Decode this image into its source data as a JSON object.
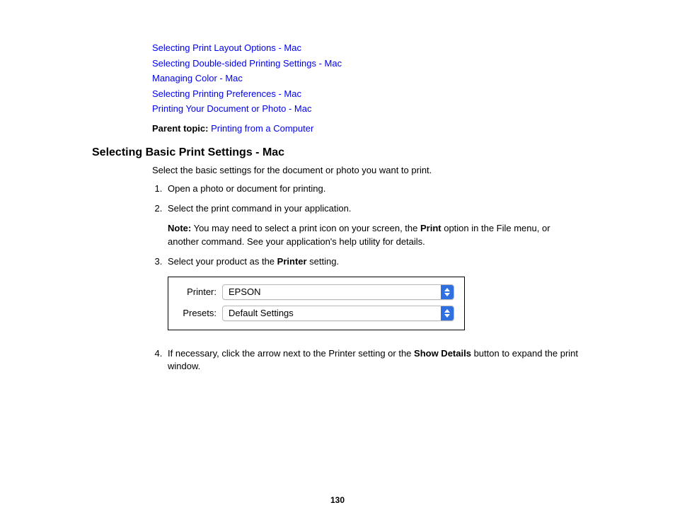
{
  "links": [
    "Selecting Print Layout Options - Mac",
    "Selecting Double-sided Printing Settings - Mac",
    "Managing Color - Mac",
    "Selecting Printing Preferences - Mac",
    "Printing Your Document or Photo - Mac"
  ],
  "parentTopic": {
    "label": "Parent topic:",
    "value": "Printing from a Computer"
  },
  "sectionTitle": "Selecting Basic Print Settings - Mac",
  "intro": "Select the basic settings for the document or photo you want to print.",
  "step1": "Open a photo or document for printing.",
  "step2": "Select the print command in your application.",
  "note": {
    "label": "Note:",
    "before": " You may need to select a print icon on your screen, the ",
    "bold": "Print",
    "after": " option in the File menu, or another command. See your application's help utility for details."
  },
  "step3": {
    "before": "Select your product as the ",
    "bold": "Printer",
    "after": " setting."
  },
  "figure": {
    "printerLabel": "Printer:",
    "printerValue": "EPSON",
    "presetsLabel": "Presets:",
    "presetsValue": "Default Settings"
  },
  "step4": {
    "before": "If necessary, click the arrow next to the Printer setting or the ",
    "bold": "Show Details",
    "after": " button to expand the print window."
  },
  "pageNumber": "130"
}
